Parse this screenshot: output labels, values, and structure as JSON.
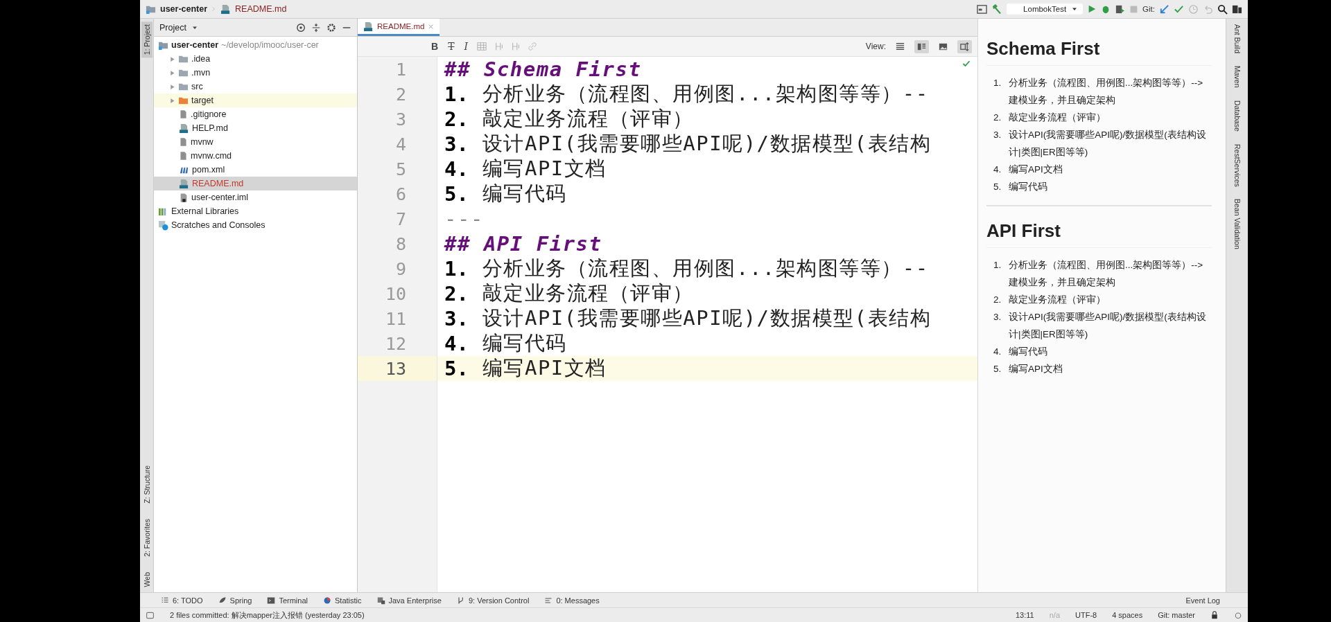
{
  "title_bar": {
    "breadcrumbs": [
      {
        "label": "user-center",
        "kind": "module"
      },
      {
        "label": "README.md",
        "kind": "markdown"
      }
    ],
    "run_config": "LombokTest",
    "git_label": "Git:"
  },
  "left_strip": [
    {
      "label": "1: Project",
      "selected": true,
      "kind": "top"
    },
    {
      "label": "Z: Structure",
      "selected": false,
      "kind": "bottom"
    },
    {
      "label": "2: Favorites",
      "selected": false,
      "kind": "bottom"
    },
    {
      "label": "Web",
      "selected": false,
      "kind": "bottom"
    }
  ],
  "project_panel": {
    "title": "Project",
    "tree": [
      {
        "name": "user-center",
        "path": "~/develop/imooc/user-cer",
        "kind": "module",
        "selected": false,
        "children": [
          {
            "name": ".idea",
            "kind": "folder",
            "expanded": false,
            "selected": false
          },
          {
            "name": ".mvn",
            "kind": "folder",
            "expanded": false,
            "selected": false
          },
          {
            "name": "src",
            "kind": "folder",
            "expanded": false,
            "selected": false
          },
          {
            "name": "target",
            "kind": "excluded-folder",
            "expanded": false,
            "selected": false
          },
          {
            "name": ".gitignore",
            "kind": "file",
            "selected": false
          },
          {
            "name": "HELP.md",
            "kind": "markdown",
            "selected": false
          },
          {
            "name": "mvnw",
            "kind": "file",
            "selected": false
          },
          {
            "name": "mvnw.cmd",
            "kind": "file",
            "selected": false
          },
          {
            "name": "pom.xml",
            "kind": "maven",
            "selected": false
          },
          {
            "name": "README.md",
            "kind": "markdown",
            "selected": true,
            "modified": true
          },
          {
            "name": "user-center.iml",
            "kind": "iml",
            "selected": false
          }
        ]
      },
      {
        "name": "External Libraries",
        "kind": "library",
        "selected": false
      },
      {
        "name": "Scratches and Consoles",
        "kind": "scratches",
        "selected": false
      }
    ]
  },
  "editor": {
    "tabs": [
      {
        "label": "README.md",
        "selected": true
      }
    ],
    "format_buttons": [
      {
        "label": "B",
        "kind": "bold"
      },
      {
        "label": "T",
        "kind": "strike"
      },
      {
        "label": "I",
        "kind": "italic"
      }
    ],
    "view_label": "View:",
    "view_modes": [
      {
        "kind": "editor",
        "selected": false
      },
      {
        "kind": "split",
        "selected": true
      },
      {
        "kind": "preview",
        "selected": false
      },
      {
        "kind": "sync",
        "selected": true
      }
    ],
    "lines": [
      {
        "number": "1",
        "kind": "heading",
        "marker": "##",
        "text": "Schema First",
        "selected": false
      },
      {
        "number": "2",
        "kind": "item",
        "marker": "1.",
        "text": "分析业务（流程图、用例图...架构图等等）--",
        "selected": false
      },
      {
        "number": "3",
        "kind": "item",
        "marker": "2.",
        "text": "敲定业务流程（评审）",
        "selected": false
      },
      {
        "number": "4",
        "kind": "item",
        "marker": "3.",
        "text": "设计API(我需要哪些API呢)/数据模型(表结构",
        "selected": false
      },
      {
        "number": "5",
        "kind": "item",
        "marker": "4.",
        "text": "编写API文档",
        "selected": false
      },
      {
        "number": "6",
        "kind": "item",
        "marker": "5.",
        "text": "编写代码",
        "selected": false
      },
      {
        "number": "7",
        "kind": "rule",
        "text": "---",
        "selected": false
      },
      {
        "number": "8",
        "kind": "heading",
        "marker": "##",
        "text": "API First",
        "selected": false
      },
      {
        "number": "9",
        "kind": "item",
        "marker": "1.",
        "text": "分析业务（流程图、用例图...架构图等等）--",
        "selected": false
      },
      {
        "number": "10",
        "kind": "item",
        "marker": "2.",
        "text": "敲定业务流程（评审）",
        "selected": false
      },
      {
        "number": "11",
        "kind": "item",
        "marker": "3.",
        "text": "设计API(我需要哪些API呢)/数据模型(表结构",
        "selected": false
      },
      {
        "number": "12",
        "kind": "item",
        "marker": "4.",
        "text": "编写代码",
        "selected": false
      },
      {
        "number": "13",
        "kind": "item",
        "marker": "5.",
        "text": "编写API文档",
        "selected": true
      }
    ]
  },
  "preview": {
    "sections": [
      {
        "heading": "Schema First",
        "items": [
          {
            "number": "1.",
            "text": "分析业务（流程图、用例图...架构图等等）--> 建模业务，并且确定架构"
          },
          {
            "number": "2.",
            "text": "敲定业务流程（评审）"
          },
          {
            "number": "3.",
            "text": "设计API(我需要哪些API呢)/数据模型(表结构设计|类图|ER图等等)"
          },
          {
            "number": "4.",
            "text": "编写API文档"
          },
          {
            "number": "5.",
            "text": "编写代码"
          }
        ]
      },
      {
        "heading": "API First",
        "items": [
          {
            "number": "1.",
            "text": "分析业务（流程图、用例图...架构图等等）--> 建模业务，并且确定架构"
          },
          {
            "number": "2.",
            "text": "敲定业务流程（评审）"
          },
          {
            "number": "3.",
            "text": "设计API(我需要哪些API呢)/数据模型(表结构设计|类图|ER图等等)"
          },
          {
            "number": "4.",
            "text": "编写代码"
          },
          {
            "number": "5.",
            "text": "编写API文档"
          }
        ]
      }
    ]
  },
  "right_strip": [
    {
      "label": "Ant Build"
    },
    {
      "label": "Maven"
    },
    {
      "label": "Database"
    },
    {
      "label": "RestServices"
    },
    {
      "label": "Bean Validation"
    }
  ],
  "tool_windows": [
    {
      "label": "6: TODO",
      "kind": "todo"
    },
    {
      "label": "Spring",
      "kind": "spring"
    },
    {
      "label": "Terminal",
      "kind": "terminal"
    },
    {
      "label": "Statistic",
      "kind": "statistic"
    },
    {
      "label": "Java Enterprise",
      "kind": "enterprise"
    },
    {
      "label": "9: Version Control",
      "kind": "vcs"
    },
    {
      "label": "0: Messages",
      "kind": "messages"
    }
  ],
  "event_log": "Event Log",
  "status_bar": {
    "message": "2 files committed: 解决mapper注入报错 (yesterday 23:05)",
    "position": "13:11",
    "line_separator": "n/a",
    "encoding": "UTF-8",
    "indent": "4 spaces",
    "branch": "Git: master"
  }
}
